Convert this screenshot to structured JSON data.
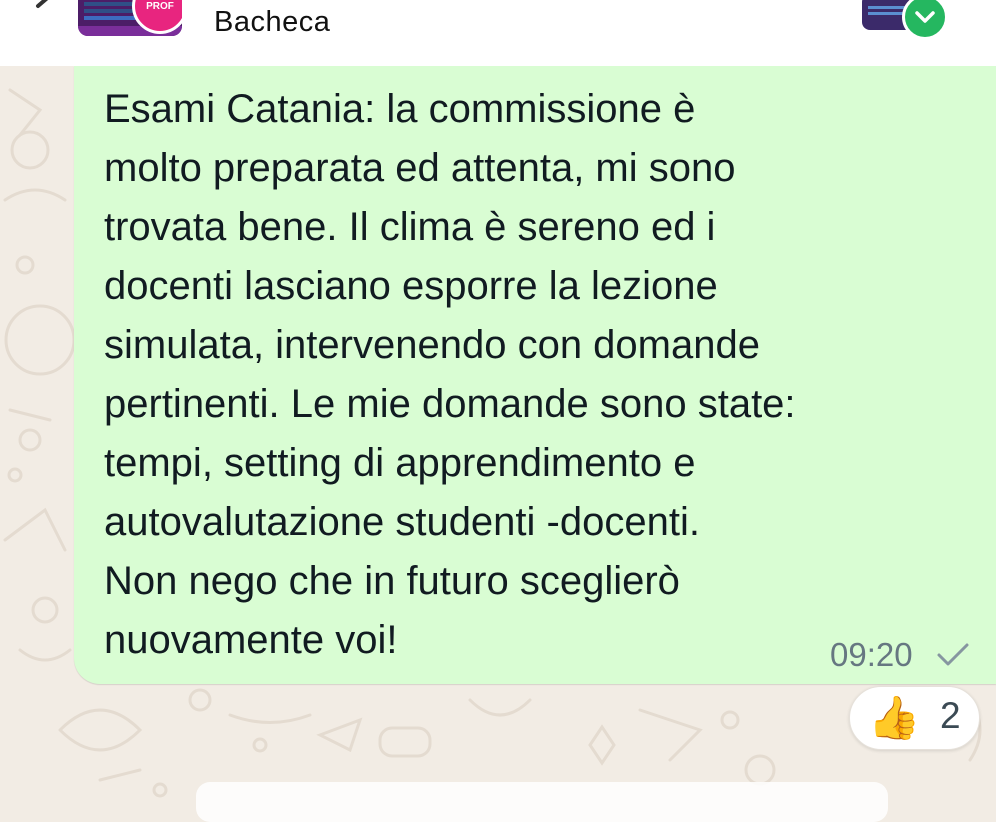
{
  "header": {
    "title": "Bacheca",
    "left_avatar_badge_text": "PROF",
    "unread_icon": "chevron-down-icon"
  },
  "message": {
    "text": "Esami Catania: la commissione è\nmolto preparata ed attenta, mi sono\ntrovata bene. Il clima è sereno ed i\ndocenti lasciano esporre la lezione\nsimulata, intervenendo con domande\npertinenti. Le mie domande sono state:\ntempi, setting di apprendimento e\nautovalutazione studenti -docenti.\nNon nego che in futuro sceglierò\nnuovamente voi!",
    "time": "09:20",
    "status_icon": "check-icon"
  },
  "reaction": {
    "emoji": "👍",
    "count": "2"
  },
  "colors": {
    "bubble": "#d9fdd3",
    "background": "#f2ece4",
    "accent_green": "#25b760"
  }
}
